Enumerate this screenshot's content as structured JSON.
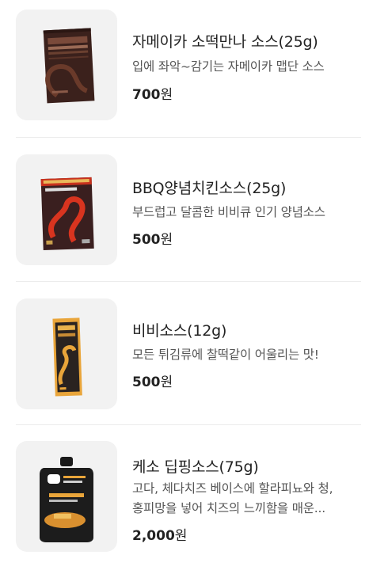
{
  "products": [
    {
      "name": "자메이카 소떡만나 소스(25g)",
      "desc": [
        "입에 좌악~감기는 자메이카 맵단 소스"
      ],
      "price": "700",
      "currency": "원",
      "image_icon": "sauce-packet-jamaica-image"
    },
    {
      "name": "BBQ양념치킨소스(25g)",
      "desc": [
        "부드럽고 달콤한 비비큐 인기 양념소스"
      ],
      "price": "500",
      "currency": "원",
      "image_icon": "sauce-packet-bbq-image"
    },
    {
      "name": "비비소스(12g)",
      "desc": [
        "모든 튀김류에 찰떡같이 어울리는 맛!"
      ],
      "price": "500",
      "currency": "원",
      "image_icon": "sauce-stick-bibi-image"
    },
    {
      "name": "케소 딥핑소스(75g)",
      "desc": [
        "고다, 체다치즈 베이스에 할라피뇨와 청,",
        "홍피망을 넣어 치즈의 느끼함을 매운..."
      ],
      "price": "2,000",
      "currency": "원",
      "image_icon": "sauce-pouch-queso-image"
    }
  ],
  "colors": {
    "text_primary": "#222222",
    "text_secondary": "#555555",
    "thumb_bg": "#f2f2f2",
    "divider": "#ececec"
  }
}
